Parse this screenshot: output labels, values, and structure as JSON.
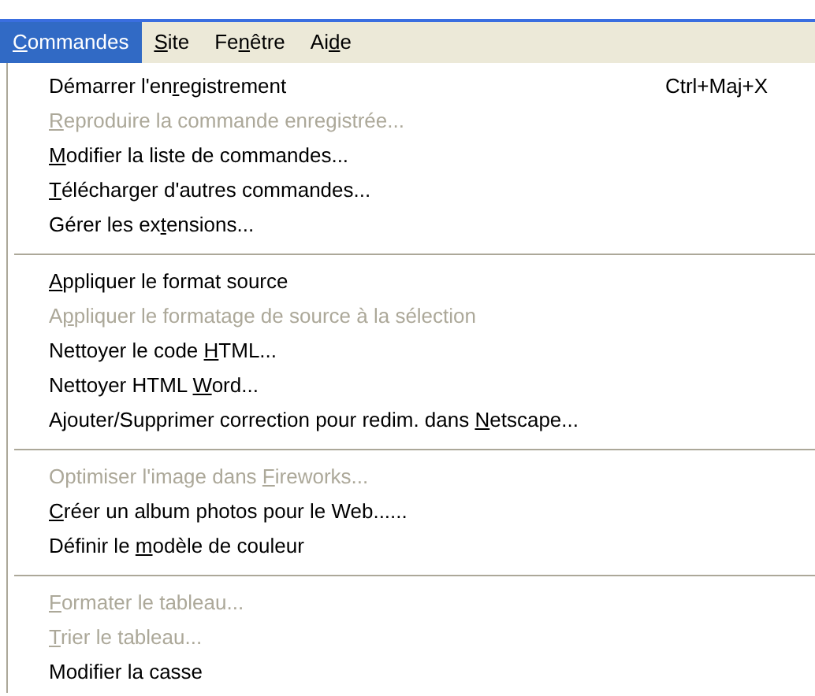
{
  "menubar": [
    {
      "access_key": "C",
      "after": "ommandes",
      "selected": true
    },
    {
      "access_key": "S",
      "after": "ite",
      "selected": false
    },
    {
      "before": "Fe",
      "access_key": "n",
      "after": "être",
      "selected": false
    },
    {
      "before": "Ai",
      "access_key": "d",
      "after": "e",
      "selected": false
    }
  ],
  "menu": {
    "sections": [
      {
        "items": [
          {
            "before": "Démarrer l'en",
            "access_key": "r",
            "after": "egistrement",
            "disabled": false,
            "shortcut": "Ctrl+Maj+X"
          },
          {
            "access_key": "R",
            "after": "eproduire la commande enregistrée...",
            "disabled": true
          },
          {
            "access_key": "M",
            "after": "odifier la liste de commandes...",
            "disabled": false
          },
          {
            "access_key": "T",
            "after": "élécharger d'autres commandes...",
            "disabled": false
          },
          {
            "before": "Gérer les ex",
            "access_key": "t",
            "after": "ensions...",
            "disabled": false
          }
        ]
      },
      {
        "items": [
          {
            "access_key": "A",
            "after": "ppliquer le format source",
            "disabled": false
          },
          {
            "before": "A",
            "access_key": "p",
            "after": "pliquer le formatage de source à la sélection",
            "disabled": true
          },
          {
            "before": "Nettoyer le code ",
            "access_key": "H",
            "after": "TML...",
            "disabled": false
          },
          {
            "before": "Nettoyer HTML ",
            "access_key": "W",
            "after": "ord...",
            "disabled": false
          },
          {
            "before": "Ajouter/Supprimer correction pour redim. dans ",
            "access_key": "N",
            "after": "etscape...",
            "disabled": false
          }
        ]
      },
      {
        "items": [
          {
            "before": "Optimiser l'image dans ",
            "access_key": "F",
            "after": "ireworks...",
            "disabled": true
          },
          {
            "access_key": "C",
            "after": "réer un album photos pour le Web......",
            "disabled": false
          },
          {
            "before": "Définir le ",
            "access_key": "m",
            "after": "odèle de couleur",
            "disabled": false
          }
        ]
      },
      {
        "items": [
          {
            "access_key": "F",
            "after": "ormater le tableau...",
            "disabled": true
          },
          {
            "access_key": "T",
            "after": "rier le tableau...",
            "disabled": true
          },
          {
            "before": "Modifier la casse",
            "disabled": false
          }
        ]
      }
    ]
  }
}
